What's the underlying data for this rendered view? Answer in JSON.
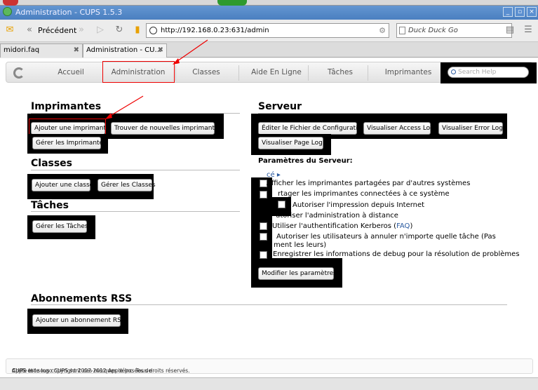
{
  "window": {
    "title": "Administration - CUPS 1.5.3"
  },
  "browser": {
    "back_label": "Précédent",
    "url": "http://192.168.0.23:631/admin",
    "search_placeholder": "Duck Duck Go",
    "tabs": [
      {
        "label": "midori.faq"
      },
      {
        "label": "Administration - CU..."
      }
    ]
  },
  "nav": {
    "items": [
      "Accueil",
      "Administration",
      "Classes",
      "Aide En Ligne",
      "Tâches",
      "Imprimantes"
    ],
    "search_placeholder": "Search Help"
  },
  "printers": {
    "title": "Imprimantes",
    "add_label": "Ajouter une imprimante",
    "find_label": "Trouver de nouvelles imprimantes",
    "manage_label": "Gérer les Imprimantes"
  },
  "classes": {
    "title": "Classes",
    "add_label": "Ajouter une classe",
    "manage_label": "Gérer les Classes"
  },
  "jobs": {
    "title": "Tâches",
    "manage_label": "Gérer les Tâches"
  },
  "rss": {
    "title": "Abonnements RSS",
    "add_label": "Ajouter un abonnement RSS"
  },
  "server": {
    "title": "Serveur",
    "edit_config_label": "Éditer le Fichier de Configuration",
    "access_log_label": "Visualiser Access Log",
    "error_log_label": "Visualiser Error Log",
    "page_log_label": "Visualiser Page Log",
    "params_title": "Paramètres du Serveur:",
    "advanced_label": "cé",
    "options": [
      "Afficher les imprimantes partagées par d'autres systèmes",
      "rtager les imprimantes connectées à ce système",
      "Autoriser l'impression depuis Internet",
      "utoriser l'administration à distance",
      "Utiliser l'authentification Kerberos (",
      "Autoriser les utilisateurs à annuler n'importe quelle tâche (Pas",
      "ment les leurs)",
      "Enregistrer les informations de debug pour la résolution de problèmes"
    ],
    "faq_label": "FAQ",
    "modify_label": "Modifier les paramètres"
  },
  "footer": {
    "text_before": "CUPS et le logo CUPS sont des marques déposées de ",
    "apple_link": "Apple Inc.",
    "text_after": " CUPS est sous copyright 2007-2012 Apple Inc. Tous droits réservés."
  }
}
